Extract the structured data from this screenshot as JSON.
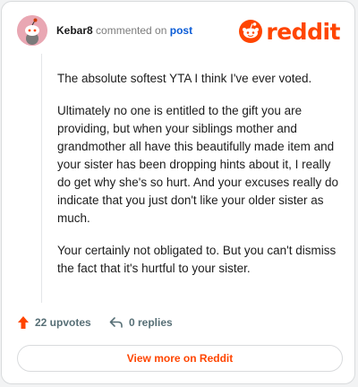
{
  "comment": {
    "author": "Kebar8",
    "action_text": "commented on",
    "post_link": "post",
    "paragraphs": [
      "The absolute softest YTA I think I've ever voted.",
      "Ultimately no one is entitled to the gift you are providing, but when your siblings mother and grandmother all have this beautifully made item and your sister has been dropping hints about it, I really do get why she's so hurt. And your excuses really do indicate that you just don't like your older sister as much.",
      "Your certainly not obligated to. But you can't dismiss the fact that it's hurtful to your sister."
    ]
  },
  "logo": {
    "wordmark": "reddit",
    "icon": "reddit-snoo-icon"
  },
  "footer": {
    "upvotes_label": "22 upvotes",
    "upvote_icon": "upvote-arrow-icon",
    "replies_label": "0 replies",
    "reply_icon": "reply-arrow-icon",
    "view_more_label": "View more on Reddit"
  },
  "colors": {
    "brand": "#ff4500",
    "link": "#0a5bd6",
    "muted": "#576f76",
    "avatar_bg": "#e9a7b3"
  }
}
